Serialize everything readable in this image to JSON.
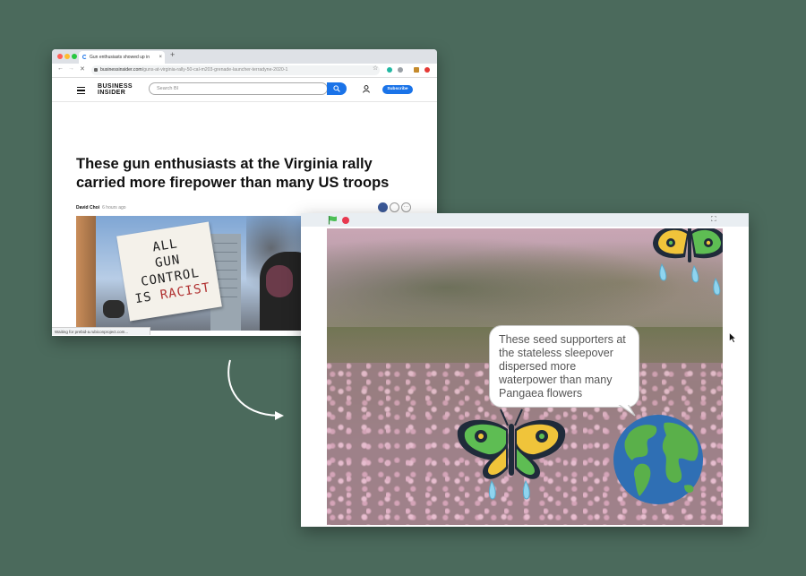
{
  "browser": {
    "tab_title": "Gun enthusiasts showed up in",
    "tab_close": "×",
    "new_tab": "+",
    "url_domain": "businessinsider.com",
    "url_path": "/guns-at-virginia-rally-50-cal-m203-grenade-launcher-terradyne-2020-1",
    "status_text": "Waiting for prebid-a.rubiconproject.com..."
  },
  "site": {
    "logo_line1": "BUSINESS",
    "logo_line2": "INSIDER",
    "search_placeholder": "Search BI",
    "subscribe_label": "Subscribe",
    "headline": "These gun enthusiasts at the Virginia rally carried more firepower than many US troops",
    "author": "David Choi",
    "timestamp": "6 hours ago",
    "sign_line1": "ALL",
    "sign_line2": "GUN CONTROL",
    "sign_line3": "IS",
    "sign_line4": "RACIST"
  },
  "stage": {
    "speech_text": "These seed supporters at the stateless sleepover dispersed more waterpower than many Pangaea flowers",
    "fullscreen_icon": "⛶"
  },
  "colors": {
    "background": "#4b6a5c",
    "accent_blue": "#1a73e8",
    "stop_red": "#e8384f",
    "flag_green": "#4cbf56"
  }
}
